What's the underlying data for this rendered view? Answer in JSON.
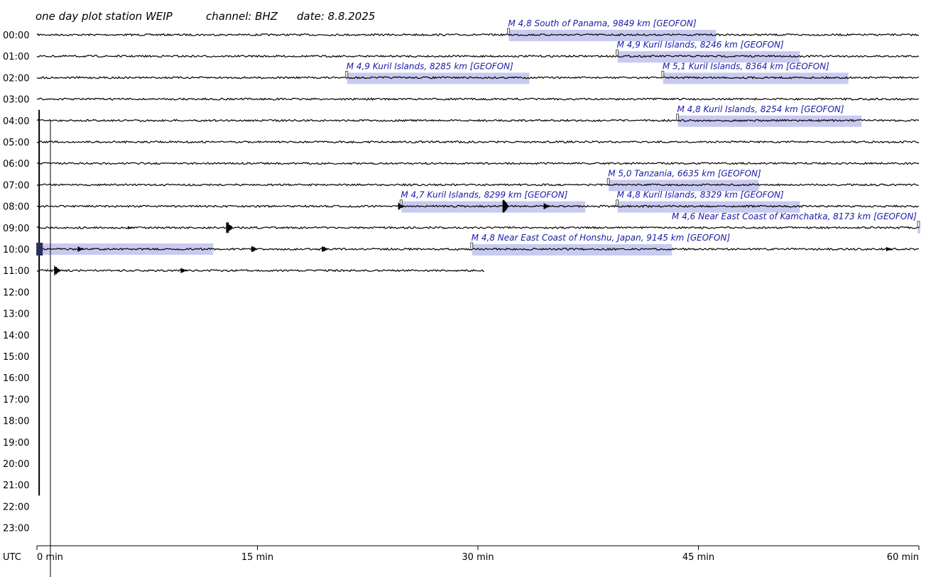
{
  "title": {
    "plot": "one day plot station WEIP",
    "channel": "channel: BHZ",
    "date": "date: 8.8.2025"
  },
  "colors": {
    "trace": "#000000",
    "event_text": "#1a1aa6",
    "event_band": "#c9caf0",
    "marker": "#555555"
  },
  "chart_data": {
    "type": "helicorder",
    "station": "WEIP",
    "channel": "BHZ",
    "date": "8.8.2025",
    "x_unit": "min",
    "xlim": [
      0,
      60
    ],
    "x_ticks": [
      {
        "value": 0,
        "label": "0 min"
      },
      {
        "value": 15,
        "label": "15 min"
      },
      {
        "value": 30,
        "label": "30 min"
      },
      {
        "value": 45,
        "label": "45 min"
      },
      {
        "value": 60,
        "label": "60 min"
      }
    ],
    "y_label": "UTC",
    "hours": [
      "00:00",
      "01:00",
      "02:00",
      "03:00",
      "04:00",
      "05:00",
      "06:00",
      "07:00",
      "08:00",
      "09:00",
      "10:00",
      "11:00",
      "12:00",
      "13:00",
      "14:00",
      "15:00",
      "16:00",
      "17:00",
      "18:00",
      "19:00",
      "20:00",
      "21:00",
      "22:00",
      "23:00"
    ],
    "data_end": {
      "hour_index": 11,
      "minute": 30.5
    },
    "cursor_minute": 0.3,
    "large_signal": {
      "minute": 0.2,
      "from_hour": 3.5,
      "to_hour": 21.5
    },
    "events": [
      {
        "label": "M 4,8 South of Panama, 9849 km  [GEOFON]",
        "hour_index": 0,
        "minute": 32.1,
        "band_end_minute": 46.2
      },
      {
        "label": "M 4,9 Kuril Islands, 8246 km  [GEOFON]",
        "hour_index": 1,
        "minute": 39.5,
        "band_end_minute": 51.9
      },
      {
        "label": "M 4,9 Kuril Islands, 8285 km  [GEOFON]",
        "hour_index": 2,
        "minute": 21.1,
        "band_end_minute": 33.5
      },
      {
        "label": "M 5,1 Kuril Islands, 8364 km  [GEOFON]",
        "hour_index": 2,
        "minute": 42.6,
        "band_end_minute": 55.2
      },
      {
        "label": "M 4,8 Kuril Islands, 8254 km  [GEOFON]",
        "hour_index": 4,
        "minute": 43.6,
        "band_end_minute": 56.1
      },
      {
        "label": "M 5,0 Tanzania, 6635 km  [GEOFON]",
        "hour_index": 7,
        "minute": 38.9,
        "band_end_minute": 49.1
      },
      {
        "label": "M 4,7 Kuril Islands, 8299 km  [GEOFON]",
        "hour_index": 8,
        "minute": 24.8,
        "band_end_minute": 37.3
      },
      {
        "label": "M 4,8 Kuril Islands, 8329 km  [GEOFON]",
        "hour_index": 8,
        "minute": 39.5,
        "band_end_minute": 51.9
      },
      {
        "label": "M 4,6 Near East Coast of Kamchatka, 8173 km  [GEOFON]",
        "hour_index": 9,
        "minute": 60.0,
        "band_end_minute": 60.0,
        "continues_minute": 12.0
      },
      {
        "label": "M 4,8 Near East Coast of Honshu, Japan, 9145 km  [GEOFON]",
        "hour_index": 10,
        "minute": 29.6,
        "band_end_minute": 43.2
      }
    ],
    "bursts": [
      {
        "hour_index": 8,
        "minute": 24.6,
        "amp": 6
      },
      {
        "hour_index": 8,
        "minute": 31.7,
        "amp": 12
      },
      {
        "hour_index": 8,
        "minute": 34.5,
        "amp": 5
      },
      {
        "hour_index": 9,
        "minute": 6.2,
        "amp": 2
      },
      {
        "hour_index": 9,
        "minute": 12.9,
        "amp": 11
      },
      {
        "hour_index": 10,
        "minute": 2.8,
        "amp": 4
      },
      {
        "hour_index": 10,
        "minute": 14.6,
        "amp": 5
      },
      {
        "hour_index": 10,
        "minute": 19.4,
        "amp": 5
      },
      {
        "hour_index": 10,
        "minute": 57.8,
        "amp": 3
      },
      {
        "hour_index": 11,
        "minute": 1.2,
        "amp": 8
      },
      {
        "hour_index": 11,
        "minute": 9.8,
        "amp": 4
      }
    ]
  }
}
